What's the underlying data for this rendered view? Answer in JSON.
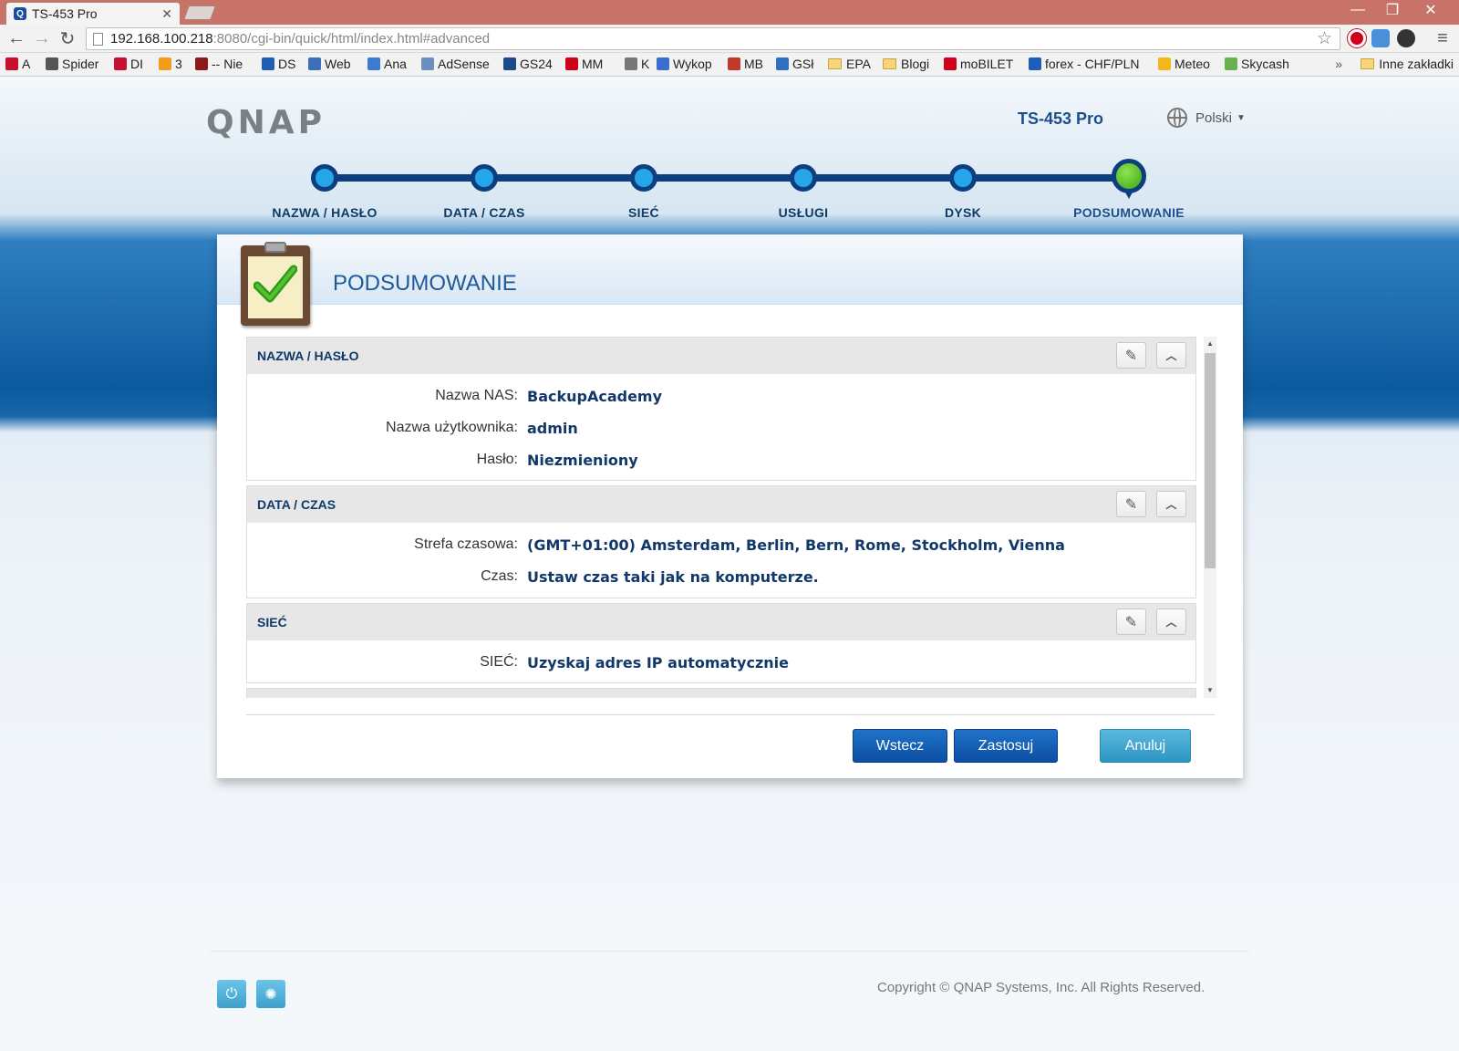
{
  "browser": {
    "tab_title": "TS-453 Pro",
    "tab_favicon": "Q",
    "url_host": "192.168.100.218",
    "url_rest": ":8080/cgi-bin/quick/html/index.html#advanced",
    "window_controls": [
      "—",
      "❐",
      "✕"
    ],
    "bookmarks": [
      {
        "label": "A",
        "color": "#c8102e"
      },
      {
        "label": "Spider",
        "color": "#555555"
      },
      {
        "label": "DI",
        "color": "#c8102e"
      },
      {
        "label": "3",
        "color": "#f29b1d"
      },
      {
        "label": "-- Nie",
        "color": "#8b1a1a"
      },
      {
        "label": "DS",
        "color": "#1d5fb8"
      },
      {
        "label": "Web",
        "color": "#3c6fb5"
      },
      {
        "label": "Ana",
        "color": "#3a7bd5"
      },
      {
        "label": "AdSense",
        "color": "#6b8fbf"
      },
      {
        "label": "GS24",
        "color": "#1a4a8a"
      },
      {
        "label": "MM",
        "color": "#d0021b"
      },
      {
        "label": "K",
        "color": "#777777"
      },
      {
        "label": "Wykop",
        "color": "#3a6ecf"
      },
      {
        "label": "MB",
        "color": "#c0392b"
      },
      {
        "label": "GSł",
        "color": "#2f6fc4"
      },
      {
        "label": "EPA",
        "folder": true
      },
      {
        "label": "Blogi",
        "folder": true
      },
      {
        "label": "moBILET",
        "color": "#d0021b"
      },
      {
        "label": "forex - CHF/PLN",
        "color": "#1d5fb8"
      },
      {
        "label": "Meteo",
        "color": "#f3b81b"
      },
      {
        "label": "Skycash",
        "color": "#6ab04c"
      }
    ],
    "overflow": "»",
    "other_bookmarks": "Inne zakładki"
  },
  "header": {
    "logo": "QNAP",
    "model": "TS-453 Pro",
    "language": "Polski"
  },
  "steps": [
    {
      "label": "NAZWA / HASŁO"
    },
    {
      "label": "DATA / CZAS"
    },
    {
      "label": "SIEĆ"
    },
    {
      "label": "USŁUGI"
    },
    {
      "label": "DYSK"
    },
    {
      "label": "PODSUMOWANIE",
      "active": true
    }
  ],
  "panel": {
    "title": "PODSUMOWANIE",
    "sections": [
      {
        "title": "NAZWA / HASŁO",
        "rows": [
          {
            "label": "Nazwa NAS:",
            "value": "BackupAcademy"
          },
          {
            "label": "Nazwa użytkownika:",
            "value": "admin"
          },
          {
            "label": "Hasło:",
            "value": "Niezmieniony"
          }
        ]
      },
      {
        "title": "DATA / CZAS",
        "rows": [
          {
            "label": "Strefa czasowa:",
            "value": "(GMT+01:00) Amsterdam, Berlin, Bern, Rome, Stockholm, Vienna"
          },
          {
            "label": "Czas:",
            "value": "Ustaw czas taki jak na komputerze."
          }
        ]
      },
      {
        "title": "SIEĆ",
        "rows": [
          {
            "label": "SIEĆ:",
            "value": "Uzyskaj adres IP automatycznie"
          }
        ]
      }
    ],
    "buttons": {
      "back": "Wstecz",
      "apply": "Zastosuj",
      "cancel": "Anuluj"
    }
  },
  "footer": {
    "copyright": "Copyright © QNAP Systems, Inc. All Rights Reserved."
  },
  "colors": {
    "accent": "#0c4ea3",
    "step_done": "#25a6e8",
    "step_active": "#3aa51a",
    "step_line": "#0d3e80"
  }
}
